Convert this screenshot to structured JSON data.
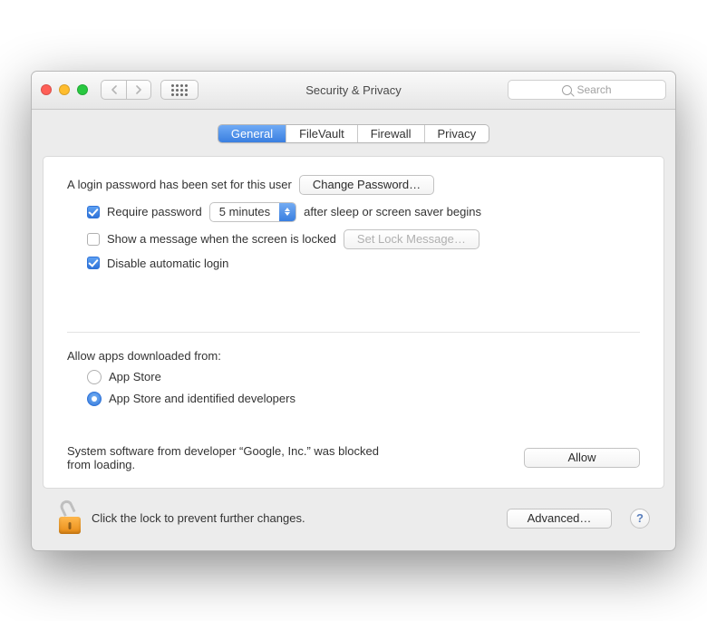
{
  "window": {
    "title": "Security & Privacy",
    "search_placeholder": "Search"
  },
  "tabs": [
    "General",
    "FileVault",
    "Firewall",
    "Privacy"
  ],
  "active_tab": "General",
  "login_password": {
    "text": "A login password has been set for this user",
    "change_button": "Change Password…"
  },
  "require_password": {
    "checked": true,
    "label_before": "Require password",
    "delay": "5 minutes",
    "label_after": "after sleep or screen saver begins"
  },
  "show_message": {
    "checked": false,
    "label": "Show a message when the screen is locked",
    "button": "Set Lock Message…"
  },
  "disable_auto_login": {
    "checked": true,
    "label": "Disable automatic login"
  },
  "allow_apps": {
    "label": "Allow apps downloaded from:",
    "options": [
      "App Store",
      "App Store and identified developers"
    ],
    "selected": "App Store and identified developers"
  },
  "blocked": {
    "text": "System software from developer “Google, Inc.” was blocked from loading.",
    "allow_button": "Allow"
  },
  "footer": {
    "lock_text": "Click the lock to prevent further changes.",
    "advanced_button": "Advanced…",
    "help": "?"
  }
}
